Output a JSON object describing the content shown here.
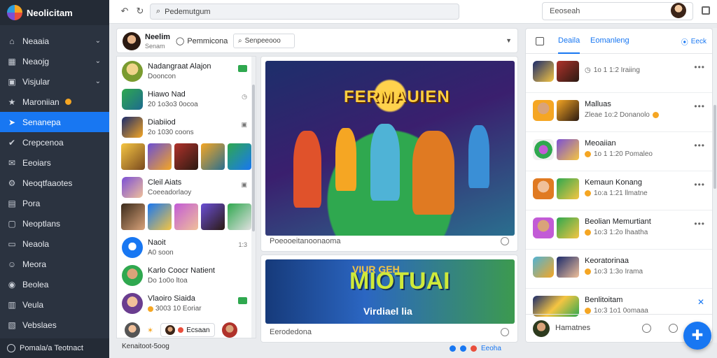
{
  "app": {
    "brand": "Neolicitam"
  },
  "sidebar": {
    "items": [
      {
        "label": "Neaaia",
        "icon": "home-icon",
        "chevron": true
      },
      {
        "label": "Neaojg",
        "icon": "grid-icon",
        "chevron": true
      },
      {
        "label": "Visjular",
        "icon": "window-icon",
        "chevron": true
      },
      {
        "label": "Maroniian",
        "icon": "star-icon",
        "badge": true
      },
      {
        "label": "Senanepa",
        "icon": "rocket-icon",
        "active": true
      },
      {
        "label": "Crepcenoa",
        "icon": "check-circle-icon"
      },
      {
        "label": "Eeoiars",
        "icon": "mail-icon"
      },
      {
        "label": "Neoqtfaaotes",
        "icon": "settings-icon"
      },
      {
        "label": "Pora",
        "icon": "folder-icon"
      },
      {
        "label": "Neoptlans",
        "icon": "box-icon"
      },
      {
        "label": "Neaola",
        "icon": "tag-icon"
      },
      {
        "label": "Meora",
        "icon": "person-icon"
      },
      {
        "label": "Beolea",
        "icon": "circle-icon"
      },
      {
        "label": "Veula",
        "icon": "note-icon"
      },
      {
        "label": "Vebslaes",
        "icon": "doc-icon"
      }
    ],
    "footer": "Pomala/a Teotnact"
  },
  "topbar": {
    "url": "Pedemutgum",
    "search": "Eeoseah"
  },
  "panel_header": {
    "name": "Neelim",
    "sub": "Senam",
    "link": "Pemmicona",
    "search": "Senpeeooo"
  },
  "chats": [
    {
      "name": "Nadangraat Alajon",
      "sub": "Dooncon",
      "meta": "badge"
    },
    {
      "name": "Hiawo Nad",
      "sub": "20 1o3o3 0ocoa",
      "meta": "clock"
    },
    {
      "name": "Diabiiod",
      "sub": "2o 1030 coons",
      "meta": "image"
    },
    {
      "name": "Cleil Aiats",
      "sub": "Coeeadorlaoy",
      "meta": "image"
    },
    {
      "name": "Naoit",
      "sub": "A0 soon",
      "meta": "1:3"
    },
    {
      "name": "Karlo Coocr Natient",
      "sub": "Do 1o0o ltoa",
      "meta": ""
    },
    {
      "name": "Vlaoiro Siaida",
      "sub": "3003 10 Eoriar",
      "meta": "badge"
    }
  ],
  "chat_bottom": {
    "pill": "Ecsaan"
  },
  "status_left": "Kenaitoot-5oog",
  "feed": {
    "post1": {
      "image_title": "FERMAUIEN",
      "caption": "Poeooeitanoonaoma"
    },
    "post2": {
      "image_title": "MIOTUAI",
      "image_kicker": "VIUR GEH",
      "image_sub": "Virdiael lia",
      "caption": "Eerodedona"
    }
  },
  "feed_status": "Eeoha",
  "right_panel": {
    "tab1": "Deaila",
    "tab2": "Eomanleng",
    "link": "Eeck",
    "items": [
      {
        "name": "",
        "sub": "1o 1 1:2 Iraiing"
      },
      {
        "name": "Malluas",
        "sub": "Zleae 1o:2 Donanolo"
      },
      {
        "name": "Meoaiian",
        "sub": "1o 1 1:20 Pomaleo"
      },
      {
        "name": "Kemaun Konang",
        "sub": "1o:a 1:21 llmatne"
      },
      {
        "name": "Beolian Memurtiant",
        "sub": "1o:3 1:2o lhaatha"
      },
      {
        "name": "Keoratorinaa",
        "sub": "1o:3 1:3o Irama"
      },
      {
        "name": "Benlitoitam",
        "sub": "1o:3 1o1 0omaaa"
      }
    ],
    "input": "Hamatnes"
  },
  "colors": {
    "accent": "#1877f2",
    "sidebar_bg": "#2b3340",
    "badge_green": "#2fa84f",
    "badge_gold": "#f5a623"
  }
}
